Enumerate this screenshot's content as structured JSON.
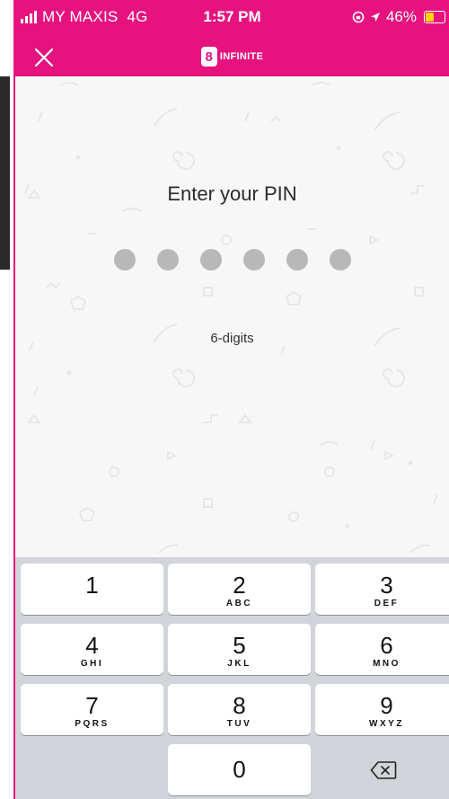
{
  "status_bar": {
    "carrier": "MY MAXIS",
    "network": "4G",
    "time": "1:57 PM",
    "battery_percent": "46%",
    "battery_color": "#ffd200",
    "icons": [
      "signal-icon",
      "rotation-lock-icon",
      "location-icon",
      "battery-icon"
    ]
  },
  "header": {
    "brand": "INFINITE",
    "brand_mark": "8",
    "accent_color": "#e6137f",
    "close_icon": "close-icon"
  },
  "pin_entry": {
    "title": "Enter your PIN",
    "digit_count": 6,
    "entered_count": 0,
    "hint": "6-digits"
  },
  "keypad": {
    "keys": [
      {
        "digit": "1",
        "letters": ""
      },
      {
        "digit": "2",
        "letters": "ABC"
      },
      {
        "digit": "3",
        "letters": "DEF"
      },
      {
        "digit": "4",
        "letters": "GHI"
      },
      {
        "digit": "5",
        "letters": "JKL"
      },
      {
        "digit": "6",
        "letters": "MNO"
      },
      {
        "digit": "7",
        "letters": "PQRS"
      },
      {
        "digit": "8",
        "letters": "TUV"
      },
      {
        "digit": "9",
        "letters": "WXYZ"
      },
      {
        "digit": "0",
        "letters": ""
      }
    ],
    "delete_icon": "backspace-icon"
  }
}
